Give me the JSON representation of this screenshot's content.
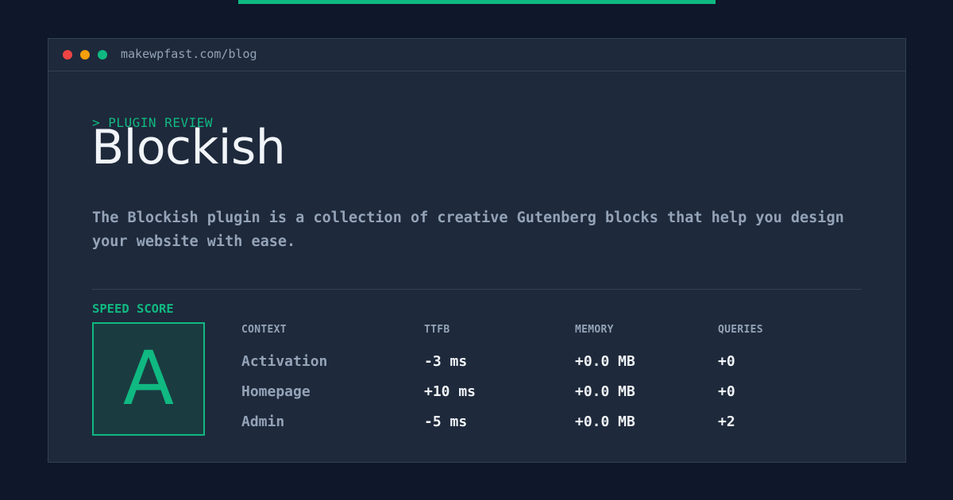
{
  "url": "makewpfast.com/blog",
  "eyebrow": "> PLUGIN REVIEW",
  "title": "Blockish",
  "description": "The Blockish plugin is a collection of creative Gutenberg blocks that help you design your website with ease.",
  "speed_score": {
    "label": "SPEED SCORE",
    "grade": "A"
  },
  "table": {
    "headers": [
      "CONTEXT",
      "TTFB",
      "MEMORY",
      "QUERIES"
    ],
    "rows": [
      [
        "Activation",
        "-3 ms",
        "+0.0 MB",
        "+0"
      ],
      [
        "Homepage",
        "+10 ms",
        "+0.0 MB",
        "+0"
      ],
      [
        "Admin",
        "-5 ms",
        "+0.0 MB",
        "+2"
      ]
    ]
  },
  "colors": {
    "background": "#0f172a",
    "panel": "#1e293b",
    "accent": "#10b981",
    "text": "#f1f5f9",
    "muted": "#94a3b8"
  }
}
